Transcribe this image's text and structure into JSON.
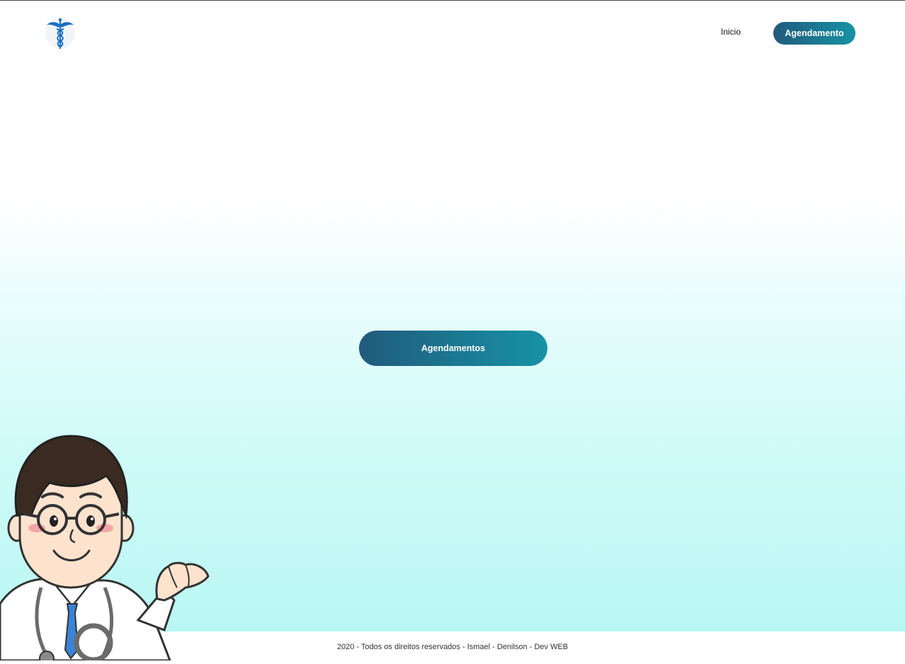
{
  "header": {
    "logo_icon": "caduceus-icon",
    "nav": {
      "home_label": "Inicio",
      "schedule_label": "Agendamento"
    }
  },
  "main": {
    "appointments_button_label": "Agendamentos",
    "illustration": "doctor-cartoon"
  },
  "footer": {
    "text": "2020 - Todos os direitos reservados - Ismael - Denilson - Dev WEB"
  },
  "colors": {
    "button_gradient_start": "#215a7d",
    "button_gradient_end": "#1693a4",
    "hero_bottom": "#b9f7f3"
  }
}
